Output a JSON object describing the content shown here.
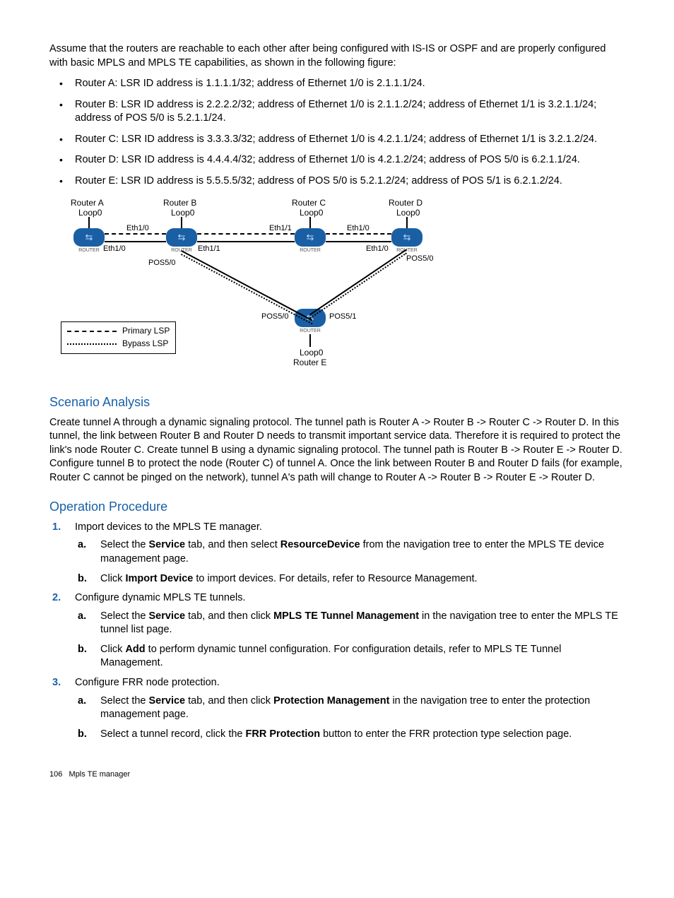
{
  "intro": "Assume that the routers are reachable to each other after being configured with IS-IS or OSPF and are properly configured with basic MPLS and MPLS TE capabilities, as shown in the following figure:",
  "routers": [
    "Router A: LSR ID address is 1.1.1.1/32; address of Ethernet 1/0 is 2.1.1.1/24.",
    "Router B: LSR ID address is 2.2.2.2/32; address of Ethernet 1/0 is 2.1.1.2/24; address of Ethernet 1/1 is 3.2.1.1/24; address of POS 5/0 is 5.2.1.1/24.",
    "Router C: LSR ID address is 3.3.3.3/32; address of Ethernet 1/0 is 4.2.1.1/24; address of Ethernet 1/1 is 3.2.1.2/24.",
    "Router D: LSR ID address is 4.4.4.4/32; address of Ethernet 1/0 is 4.2.1.2/24; address of POS 5/0 is 6.2.1.1/24.",
    "Router E: LSR ID address is 5.5.5.5/32; address of POS 5/0 is 5.2.1.2/24; address of POS 5/1 is 6.2.1.2/24."
  ],
  "diagram": {
    "ra": "Router A",
    "rb": "Router B",
    "rc": "Router C",
    "rd": "Router D",
    "re": "Router E",
    "loop": "Loop0",
    "eth10": "Eth1/0",
    "eth11": "Eth1/1",
    "pos50": "POS5/0",
    "pos51": "POS5/1",
    "router_label": "ROUTER",
    "legend_primary": "Primary LSP",
    "legend_bypass": "Bypass LSP"
  },
  "scenario": {
    "heading": "Scenario Analysis",
    "text": "Create tunnel A through a dynamic signaling protocol. The tunnel path is Router A -> Router B -> Router C -> Router D. In this tunnel, the link between Router B and Router D needs to transmit important service data. Therefore it is required to protect the link's node Router C. Create tunnel B using a dynamic signaling protocol. The tunnel path is Router B -> Router E -> Router D. Configure tunnel B to protect the node (Router C) of tunnel A. Once the link between Router B and Router D fails (for example, Router C cannot be pinged on the network), tunnel A's path will change to Router A -> Router B -> Router E -> Router D."
  },
  "operation": {
    "heading": "Operation Procedure",
    "steps": [
      {
        "text": "Import devices to the MPLS TE manager.",
        "sub": [
          {
            "pre": "Select the ",
            "b1": "Service",
            "mid": " tab, and then select ",
            "b2": "ResourceDevice",
            "post": " from the navigation tree to enter the MPLS TE device management page."
          },
          {
            "pre": "Click ",
            "b1": "Import Device",
            "mid": " to import devices. For details, refer to Resource Management.",
            "b2": "",
            "post": ""
          }
        ]
      },
      {
        "text": "Configure dynamic MPLS TE tunnels.",
        "sub": [
          {
            "pre": "Select the ",
            "b1": "Service",
            "mid": " tab, and then click ",
            "b2": "MPLS TE Tunnel Management",
            "post": " in the navigation tree to enter the MPLS TE tunnel list page."
          },
          {
            "pre": "Click ",
            "b1": "Add",
            "mid": " to perform dynamic tunnel configuration. For configuration details, refer to MPLS TE Tunnel Management.",
            "b2": "",
            "post": ""
          }
        ]
      },
      {
        "text": "Configure FRR node protection.",
        "sub": [
          {
            "pre": "Select the ",
            "b1": "Service",
            "mid": " tab, and then click ",
            "b2": "Protection Management",
            "post": " in the navigation tree to enter the protection management page."
          },
          {
            "pre": "Select a tunnel record, click the ",
            "b1": "FRR Protection",
            "mid": " button to enter the FRR protection type selection page.",
            "b2": "",
            "post": ""
          }
        ]
      }
    ]
  },
  "footer": {
    "page": "106",
    "title": "Mpls TE manager"
  }
}
